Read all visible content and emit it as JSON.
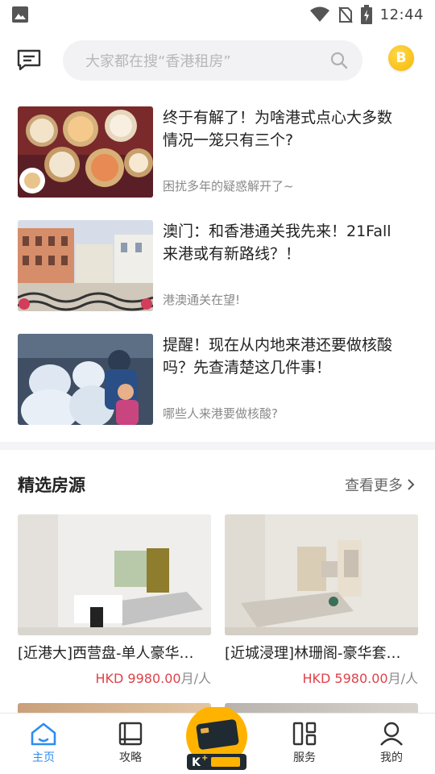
{
  "status_bar": {
    "time": "12:44"
  },
  "header": {
    "search_placeholder": "大家都在搜“香港租房”",
    "coin_label": "B"
  },
  "articles": [
    {
      "title": "终于有解了！为啥港式点心大多数情况一笼只有三个?",
      "subtitle": "困扰多年的疑惑解开了~"
    },
    {
      "title": "澳门：和香港通关我先来！21Fall来港或有新路线？！",
      "subtitle": "港澳通关在望!"
    },
    {
      "title": "提醒！现在从内地来港还要做核酸吗？先查清楚这几件事！",
      "subtitle": "哪些人来港要做核酸?"
    }
  ],
  "featured": {
    "title": "精选房源",
    "see_more": "查看更多",
    "listings": [
      {
        "name": "[近港大]西营盘-单人豪华…",
        "price": "HKD 9980.00",
        "unit": "月/人"
      },
      {
        "name": "[近城浸理]林珊阁-豪华套…",
        "price": "HKD 5980.00",
        "unit": "月/人"
      }
    ]
  },
  "bottom_nav": {
    "items": [
      {
        "label": "主页",
        "icon": "home-icon",
        "active": true
      },
      {
        "label": "攻略",
        "icon": "book-icon",
        "active": false
      },
      {
        "label": "K+管家",
        "icon": "k-card-icon",
        "active": false
      },
      {
        "label": "服务",
        "icon": "grid-icon",
        "active": false
      },
      {
        "label": "我的",
        "icon": "user-icon",
        "active": false
      }
    ]
  },
  "colors": {
    "accent": "#2b8ef0",
    "price": "#e0424a",
    "coin": "#f6b700",
    "k_button": "#ffb300"
  }
}
